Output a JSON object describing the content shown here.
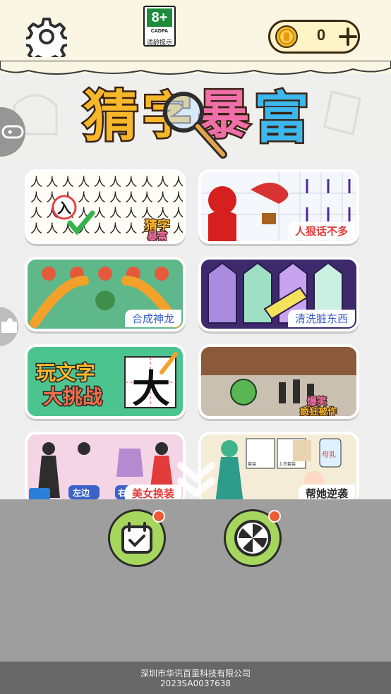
{
  "header": {
    "age_rating": "8+",
    "age_org": "CADPA",
    "age_tip": "适龄提示",
    "coins": "0"
  },
  "logo_text": "猜字暴富",
  "games": [
    {
      "label": "猜字暴富"
    },
    {
      "label": "人狠话不多"
    },
    {
      "label": "合成神龙"
    },
    {
      "label": "清洗脏东西"
    },
    {
      "label": "玩文字大挑战"
    },
    {
      "label": "爆笑疯狂被作"
    },
    {
      "label": "美女换装"
    },
    {
      "label": "帮她逆袭"
    }
  ],
  "card_texts": {
    "char_grid": "入",
    "big_char": "大",
    "tag_left": "左边",
    "tag_right": "右",
    "doll_items": [
      "套装",
      "上衣套装"
    ],
    "milk": "母乳"
  },
  "footer": {
    "company": "深圳市华讯百里科技有限公司",
    "license": "2023SA0037638"
  },
  "colors": {
    "accent_green": "#a6d65e",
    "notify_red": "#ee5a35",
    "label_red": "#e23b3b"
  },
  "icons": [
    "gear-icon",
    "coin-icon",
    "plus-icon",
    "calendar-icon",
    "lime-wheel-icon",
    "chevron-down-icon",
    "gamepad-icon",
    "puzzle-icon"
  ]
}
